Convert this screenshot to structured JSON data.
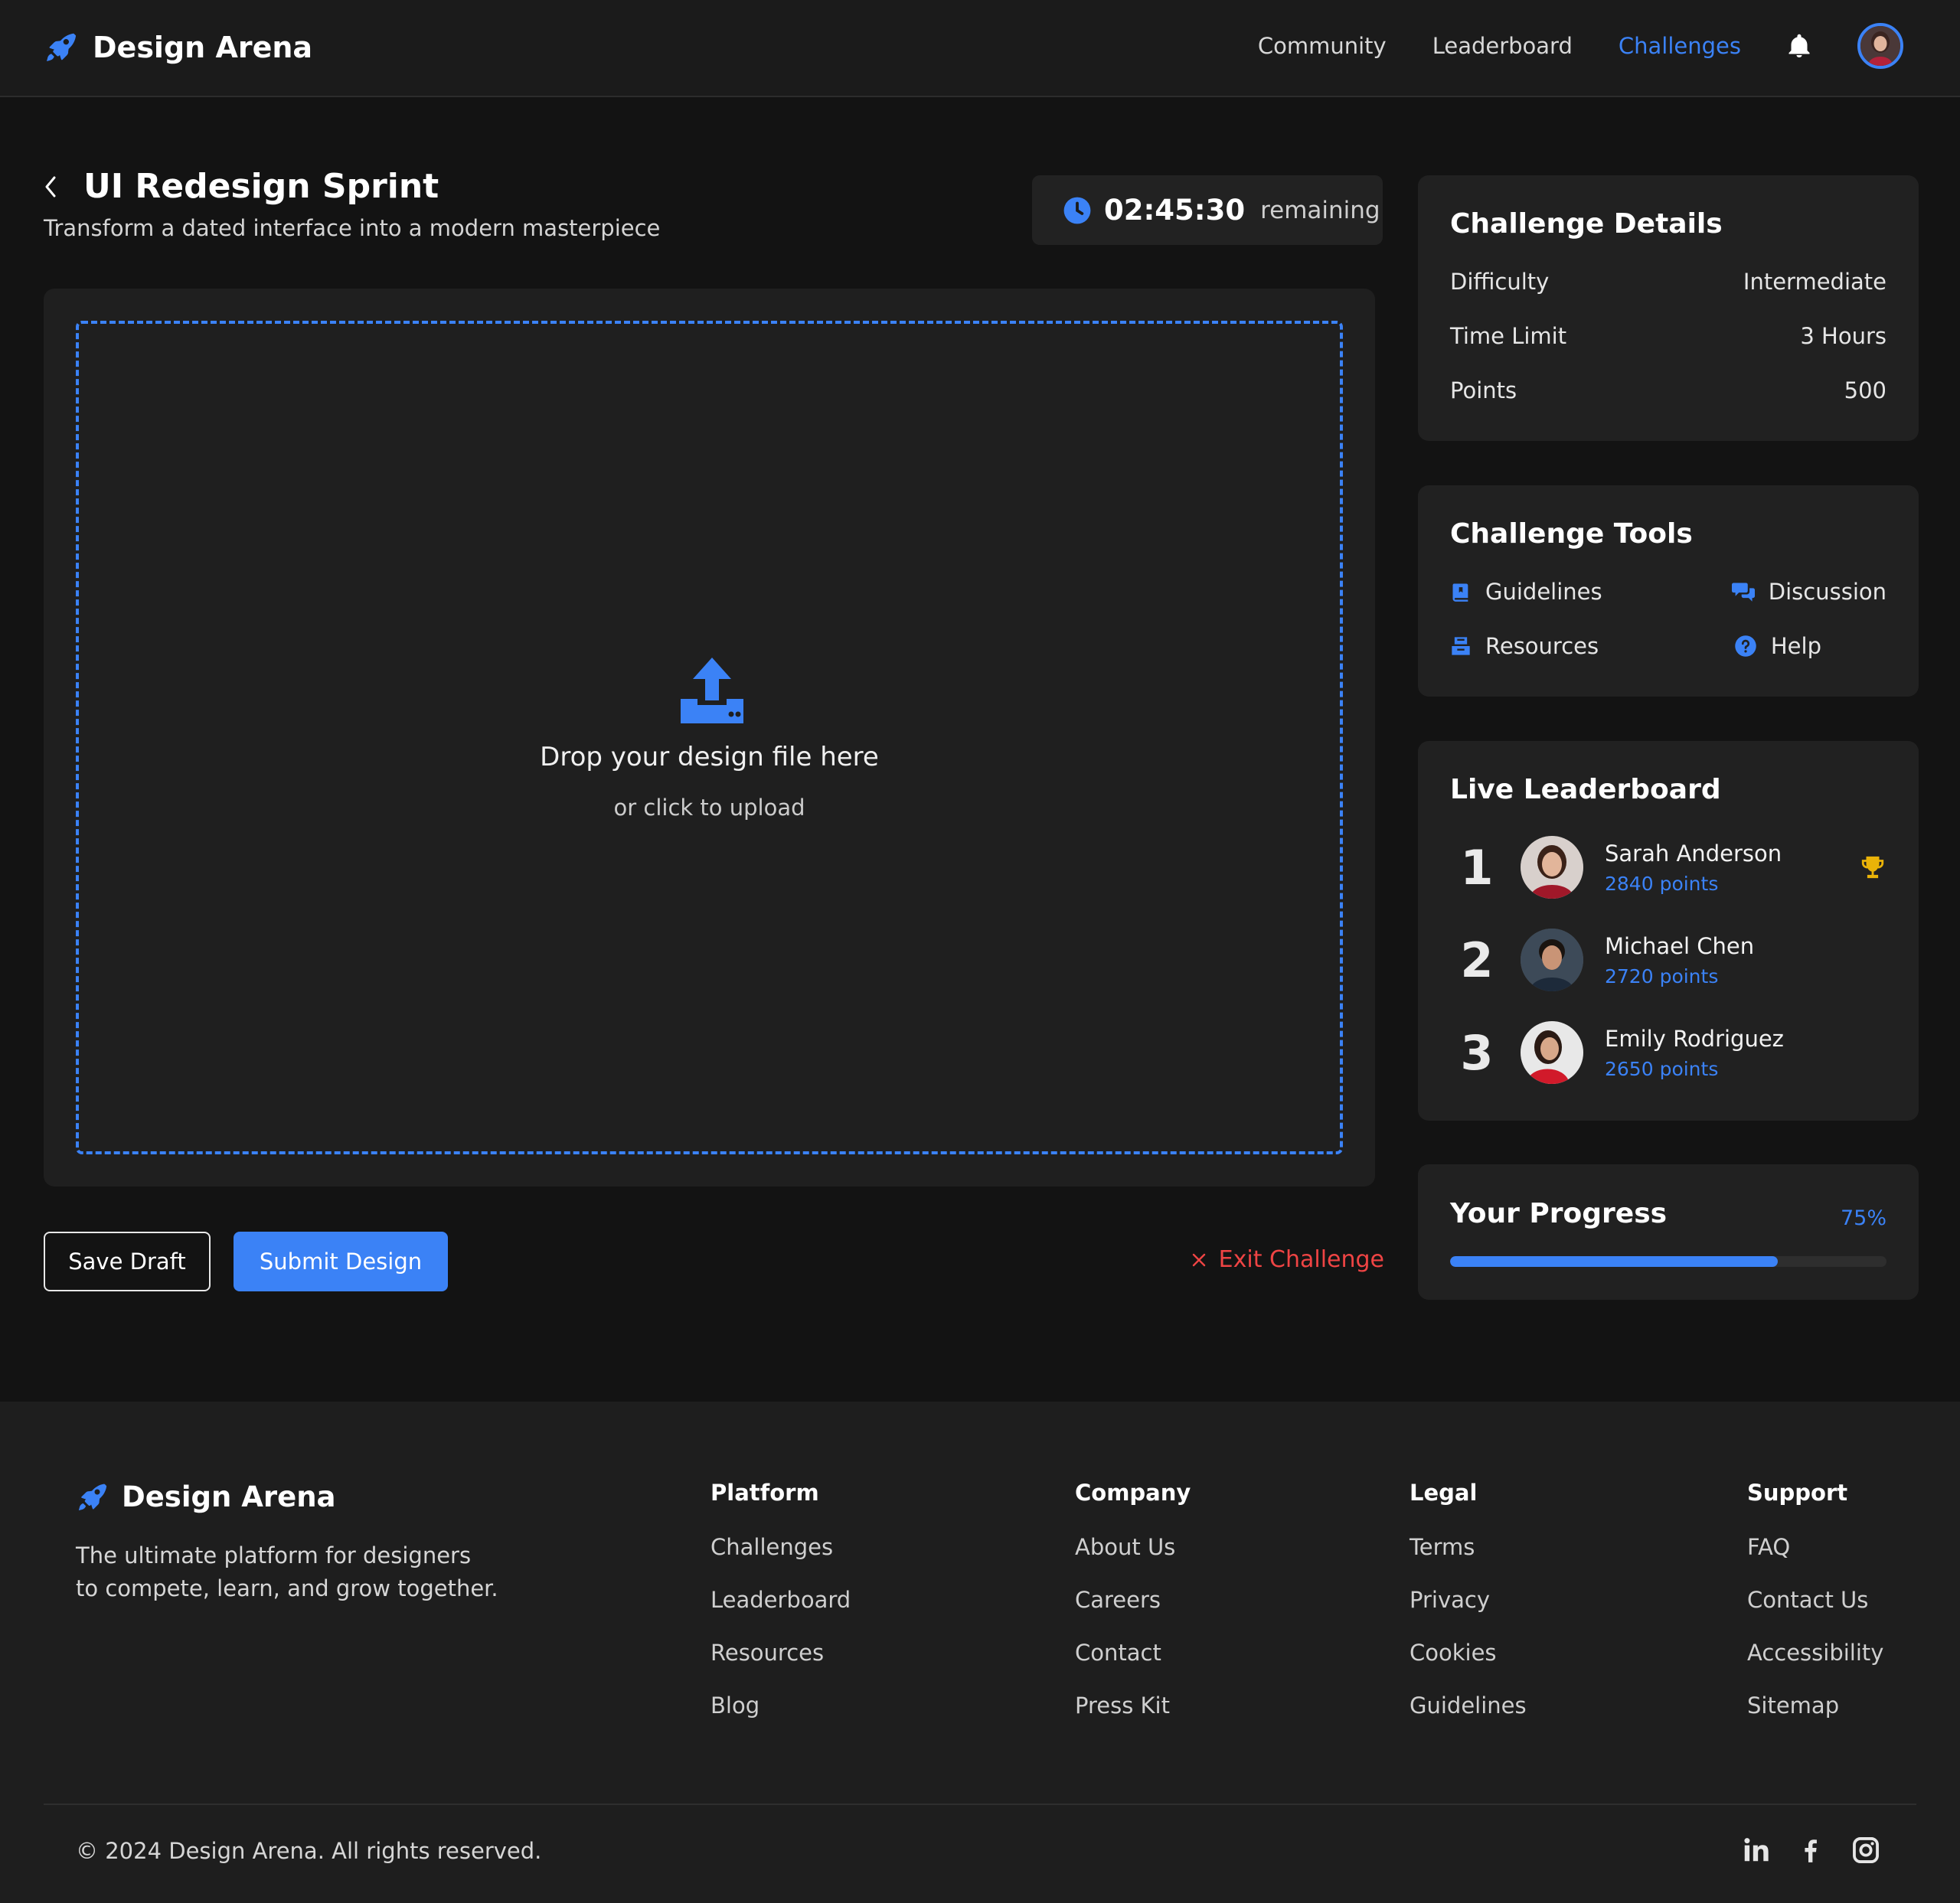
{
  "header": {
    "brand": "Design Arena",
    "nav": [
      {
        "label": "Community",
        "active": false
      },
      {
        "label": "Leaderboard",
        "active": false
      },
      {
        "label": "Challenges",
        "active": true
      }
    ]
  },
  "challenge": {
    "title": "UI Redesign Sprint",
    "subtitle": "Transform a dated interface into a modern masterpiece",
    "timer": {
      "value": "02:45:30",
      "label": "remaining"
    }
  },
  "upload": {
    "title": "Drop your design file here",
    "subtitle": "or click to upload"
  },
  "actions": {
    "save_draft": "Save Draft",
    "submit": "Submit Design",
    "exit": "Exit Challenge"
  },
  "details": {
    "title": "Challenge Details",
    "rows": [
      {
        "label": "Difficulty",
        "value": "Intermediate"
      },
      {
        "label": "Time Limit",
        "value": "3 Hours"
      },
      {
        "label": "Points",
        "value": "500"
      }
    ]
  },
  "tools": {
    "title": "Challenge Tools",
    "items": [
      {
        "label": "Guidelines",
        "icon": "book-icon"
      },
      {
        "label": "Discussion",
        "icon": "chat-icon"
      },
      {
        "label": "Resources",
        "icon": "archive-icon"
      },
      {
        "label": "Help",
        "icon": "question-icon"
      }
    ]
  },
  "leaderboard": {
    "title": "Live Leaderboard",
    "entries": [
      {
        "rank": "1",
        "name": "Sarah Anderson",
        "points": "2840 points"
      },
      {
        "rank": "2",
        "name": "Michael Chen",
        "points": "2720 points"
      },
      {
        "rank": "3",
        "name": "Emily Rodriguez",
        "points": "2650 points"
      }
    ]
  },
  "progress": {
    "title": "Your Progress",
    "label": "75%",
    "value": 0.75
  },
  "footer": {
    "brand": "Design Arena",
    "tagline_line1": "The ultimate platform for designers",
    "tagline_line2": "to compete, learn, and grow together.",
    "columns": [
      {
        "title": "Platform",
        "links": [
          "Challenges",
          "Leaderboard",
          "Resources",
          "Blog"
        ]
      },
      {
        "title": "Company",
        "links": [
          "About Us",
          "Careers",
          "Contact",
          "Press Kit"
        ]
      },
      {
        "title": "Legal",
        "links": [
          "Terms",
          "Privacy",
          "Cookies",
          "Guidelines"
        ]
      },
      {
        "title": "Support",
        "links": [
          "FAQ",
          "Contact Us",
          "Accessibility",
          "Sitemap"
        ]
      }
    ],
    "copyright": "© 2024 Design Arena. All rights reserved.",
    "social": [
      "linkedin-icon",
      "facebook-icon",
      "instagram-icon"
    ]
  },
  "colors": {
    "accent": "#3b82f6",
    "danger": "#ef4444",
    "trophy": "#eab308",
    "background": "#131313",
    "card": "#212121"
  }
}
